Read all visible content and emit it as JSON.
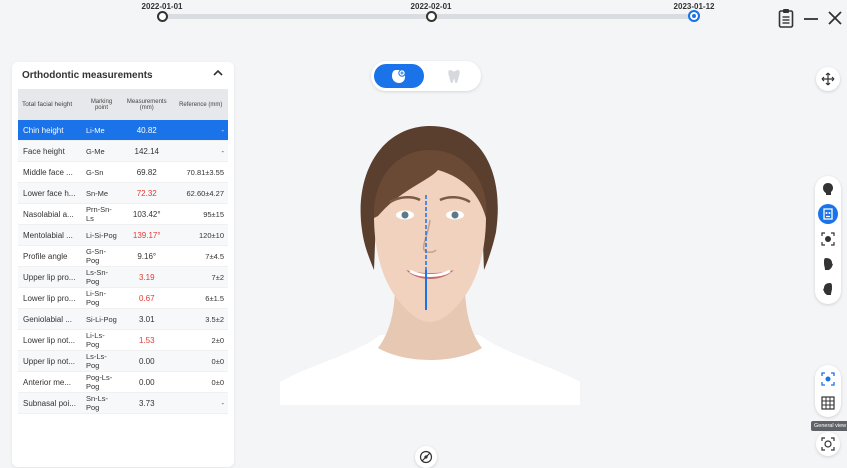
{
  "timeline": {
    "dates": [
      "2022-01-01",
      "2022-02-01",
      "2023-01-12"
    ],
    "active_index": 2
  },
  "window": {
    "report_icon": "clipboard-icon",
    "minimize_icon": "minimize-icon",
    "close_icon": "close-icon"
  },
  "panel": {
    "title": "Orthodontic measurements",
    "collapse_icon": "chevron-up-icon",
    "headers": [
      "Total facial height",
      "Marking point",
      "Measurements (mm)",
      "Reference (mm)"
    ],
    "rows": [
      {
        "name": "Chin height",
        "point": "Li-Me",
        "value": "40.82",
        "reference": "-",
        "highlight": false,
        "selected": true
      },
      {
        "name": "Face height",
        "point": "G-Me",
        "value": "142.14",
        "reference": "-",
        "highlight": false,
        "selected": false
      },
      {
        "name": "Middle face ...",
        "point": "G-Sn",
        "value": "69.82",
        "reference": "70.81±3.55",
        "highlight": false,
        "selected": false
      },
      {
        "name": "Lower face h...",
        "point": "Sn-Me",
        "value": "72.32",
        "reference": "62.60±4.27",
        "highlight": true,
        "selected": false
      },
      {
        "name": "Nasolabial a...",
        "point": "Prn-Sn-Ls",
        "value": "103.42°",
        "reference": "95±15",
        "highlight": false,
        "selected": false
      },
      {
        "name": "Mentolabial ...",
        "point": "Li-Si-Pog",
        "value": "139.17°",
        "reference": "120±10",
        "highlight": true,
        "selected": false
      },
      {
        "name": "Profile angle",
        "point": "G-Sn-Pog",
        "value": "9.16°",
        "reference": "7±4.5",
        "highlight": false,
        "selected": false
      },
      {
        "name": "Upper lip pro...",
        "point": "Ls-Sn-Pog",
        "value": "3.19",
        "reference": "7±2",
        "highlight": true,
        "selected": false
      },
      {
        "name": "Lower lip pro...",
        "point": "Li-Sn-Pog",
        "value": "0.67",
        "reference": "6±1.5",
        "highlight": true,
        "selected": false
      },
      {
        "name": "Geniolabial ...",
        "point": "Si-Li-Pog",
        "value": "3.01",
        "reference": "3.5±2",
        "highlight": false,
        "selected": false
      },
      {
        "name": "Lower lip not...",
        "point": "Li-Ls-Pog",
        "value": "1.53",
        "reference": "2±0",
        "highlight": true,
        "selected": false
      },
      {
        "name": "Upper lip not...",
        "point": "Ls-Ls-Pog",
        "value": "0.00",
        "reference": "0±0",
        "highlight": false,
        "selected": false
      },
      {
        "name": "Anterior me...",
        "point": "Pog-Ls-Pog",
        "value": "0.00",
        "reference": "0±0",
        "highlight": false,
        "selected": false
      },
      {
        "name": "Subnasal poi...",
        "point": "Sn-Ls-Pog",
        "value": "3.73",
        "reference": "-",
        "highlight": false,
        "selected": false
      }
    ]
  },
  "view_toggle": {
    "options": [
      "face-scan-icon",
      "tooth-icon"
    ],
    "active_index": 0
  },
  "toolbar": {
    "move_icon": "move-icon",
    "side_icons": [
      "head-icon",
      "face-front-icon",
      "face-zoom-icon",
      "profile-right-icon",
      "profile-left-icon"
    ],
    "active_side_index": 1,
    "view_icons": [
      "focus-icon",
      "grid-icon"
    ],
    "tooltip": "General view",
    "bottom_icon": "reset-view-icon",
    "accent": "#1a73e8"
  }
}
